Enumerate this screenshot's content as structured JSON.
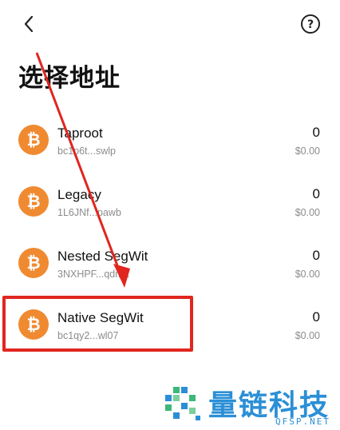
{
  "header": {
    "back_icon": "chevron-left-icon",
    "help_icon": "question-circle-icon",
    "help_symbol": "?"
  },
  "page_title": "选择地址",
  "coin_icon": "bitcoin-icon",
  "coin_symbol": "₿",
  "addresses": [
    {
      "name": "Taproot",
      "address": "bc1p6t...swlp",
      "amount": "0",
      "fiat": "$0.00"
    },
    {
      "name": "Legacy",
      "address": "1L6JNf...pawb",
      "amount": "0",
      "fiat": "$0.00"
    },
    {
      "name": "Nested SegWit",
      "address": "3NXHPF...qdma",
      "amount": "0",
      "fiat": "$0.00"
    },
    {
      "name": "Native SegWit",
      "address": "bc1qy2...wl07",
      "amount": "0",
      "fiat": "$0.00"
    }
  ],
  "annotation": {
    "highlight_color": "#e0261f",
    "arrow_color": "#e0261f"
  },
  "watermark": {
    "text": "量链科技",
    "url": "QFSP.NET",
    "color": "#2b8fd6"
  },
  "colors": {
    "bitcoin_orange": "#f08a31",
    "text_primary": "#111111",
    "text_secondary": "#8c8c8c"
  }
}
